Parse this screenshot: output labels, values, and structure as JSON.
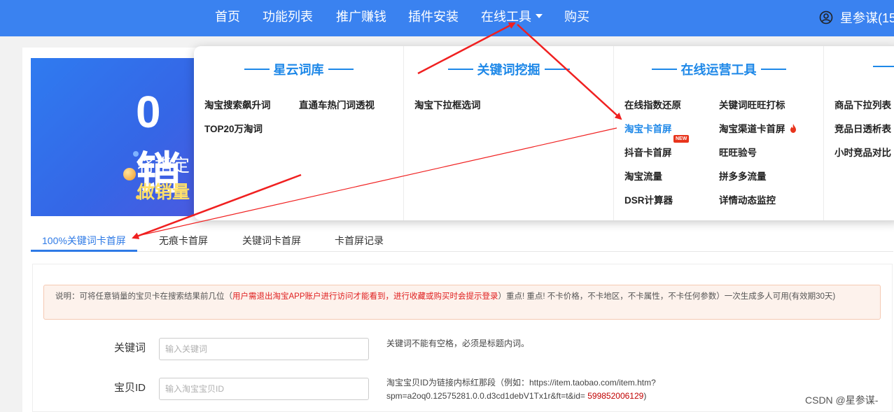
{
  "nav": {
    "items": [
      "首页",
      "功能列表",
      "推广赚钱",
      "插件安装",
      "在线工具",
      "购买"
    ],
    "user": "星参谋(15",
    "color": "#3a82f0"
  },
  "banner": {
    "big": "0销",
    "line1": "将指定",
    "line2": "做销量"
  },
  "dropdown": {
    "col1": {
      "title": "星云词库",
      "items": [
        "淘宝搜索飙升词",
        "直通车热门词透视",
        "TOP20万淘词"
      ]
    },
    "col2": {
      "title": "关键词挖掘",
      "items": [
        "淘宝下拉框选词"
      ]
    },
    "col3": {
      "title": "在线运营工具",
      "items": [
        "在线指数还原",
        "关键词旺旺打标",
        "淘宝卡首屏",
        "淘宝渠道卡首屏",
        "抖音卡首屏",
        "旺旺验号",
        "淘宝流量",
        "拼多多流量",
        "DSR计算器",
        "详情动态监控"
      ],
      "new_badge": "NEW"
    },
    "col4": {
      "items": [
        "商品下拉列表",
        "竞品日透析表",
        "小时竞品对比"
      ]
    }
  },
  "tabs": [
    "100%关键词卡首屏",
    "无痕卡首屏",
    "关键词卡首屏",
    "卡首屏记录"
  ],
  "notice": {
    "prefix": "说明：可将任意销量的宝贝卡在搜索结果前几位（",
    "red": "用户需退出淘宝APP账户进行访问才能看到，进行收藏或购买时会提示登录",
    "suffix": "）重点! 重点! 不卡价格，不卡地区，不卡属性，不卡任何参数）一次生成多人可用(有效期30天)"
  },
  "form": {
    "keyword_label": "关键词",
    "keyword_placeholder": "输入关键词",
    "keyword_hint": "关键词不能有空格，必须是标题内词。",
    "itemid_label": "宝贝ID",
    "itemid_placeholder": "输入淘宝宝贝ID",
    "itemid_hint_1": "淘宝宝贝ID为链接内标红那段（例如：https://item.taobao.com/item.htm?",
    "itemid_hint_2": "spm=a2oq0.12575281.0.0.d3cd1debV1Tx1r&ft=t&id=",
    "itemid_hint_red": "599852006129",
    "itemid_hint_end": ")"
  },
  "watermark": "CSDN @星参谋-"
}
